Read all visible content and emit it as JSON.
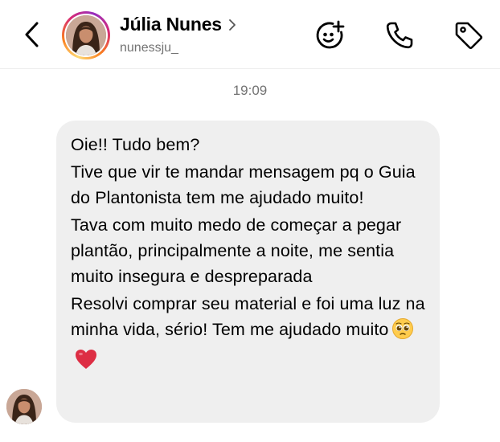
{
  "header": {
    "name": "Júlia Nunes",
    "username": "nunessju_",
    "icons": {
      "back": "chevron-left-icon",
      "chevron": "chevron-right-icon",
      "sticker": "sticker-icon",
      "call": "phone-icon",
      "label": "tag-icon"
    }
  },
  "thread": {
    "timestamp": "19:09",
    "message": {
      "p1": "Oie!! Tudo bem?",
      "p2": "Tive que vir te mandar mensagem pq o Guia do Plantonista tem me ajudado muito!",
      "p3": "Tava com muito medo de começar a pegar plantão, principalmente a noite, me sentia muito insegura e despreparada",
      "p4": "Resolvi comprar seu material e foi uma luz na minha vida, sério! Tem me ajudado muito",
      "emojis": [
        "pleading-face-emoji",
        "red-heart-emoji"
      ]
    }
  },
  "colors": {
    "bubble": "#efefef",
    "secondary_text": "#737373"
  }
}
